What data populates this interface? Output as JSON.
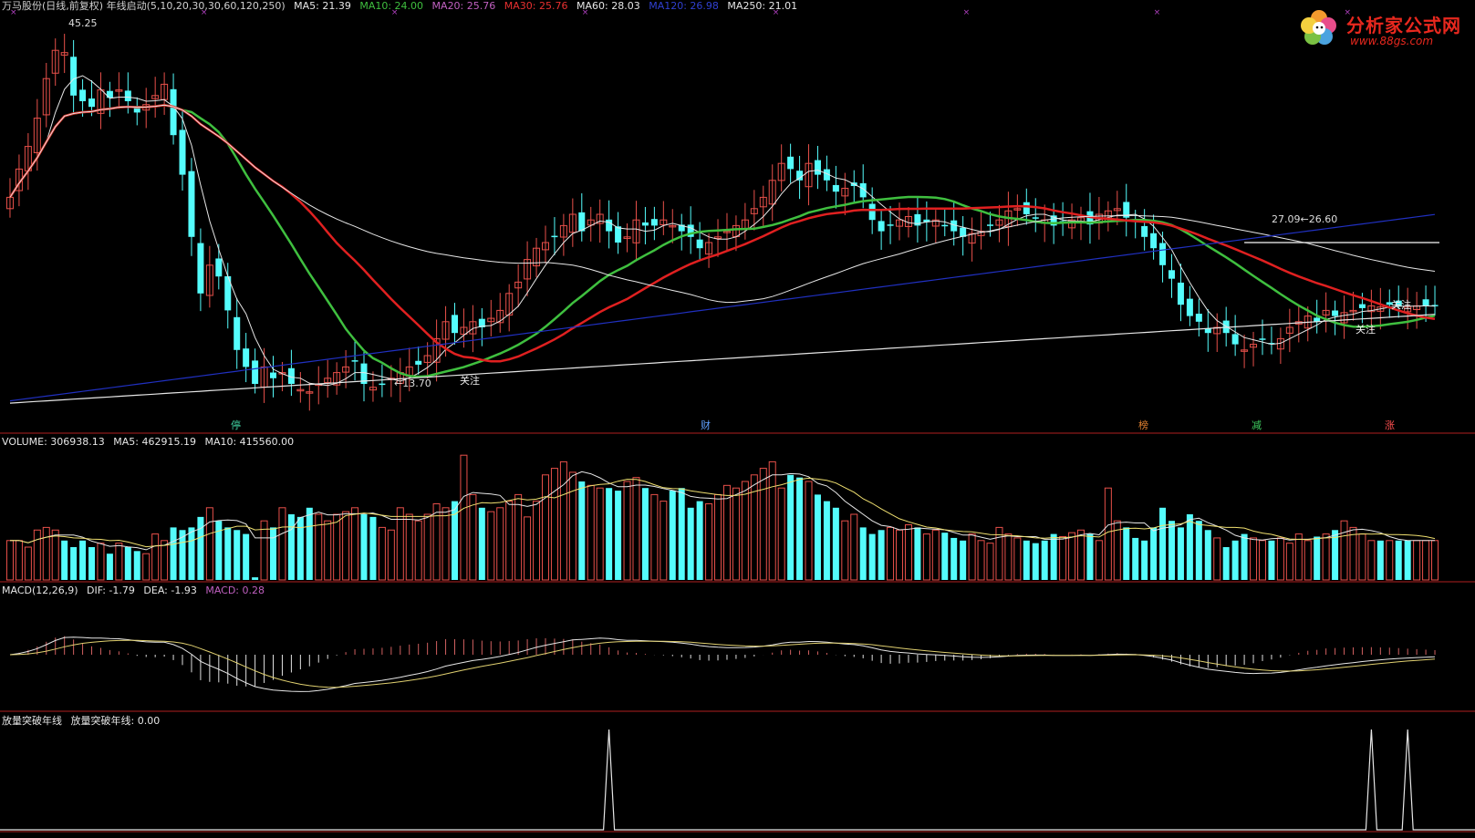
{
  "header": {
    "title": "万马股份(日线,前复权) 年线启动(5,10,20,30,30,60,120,250)",
    "ma": [
      {
        "label": "MA5: 21.39",
        "color": "#e6e6e6"
      },
      {
        "label": "MA10: 24.00",
        "color": "#3fbf3f"
      },
      {
        "label": "MA20: 25.76",
        "color": "#c060c0"
      },
      {
        "label": "MA30: 25.76",
        "color": "#e83030"
      },
      {
        "label": "MA60: 28.03",
        "color": "#e6e6e6"
      },
      {
        "label": "MA120: 26.98",
        "color": "#3040d0"
      },
      {
        "label": "MA250: 21.01",
        "color": "#e6e6e6"
      }
    ]
  },
  "logo": {
    "text": "分析家公式网",
    "url": "www.88gs.com"
  },
  "price_annotations": {
    "high": "45.25",
    "low": "←13.70",
    "range": "27.09←26.60",
    "focus": "关注"
  },
  "bottom_markers": [
    "停",
    "财",
    "榜",
    "减",
    "涨"
  ],
  "volume_header": {
    "label": "VOLUME: 306938.13",
    "ma5": "MA5: 462915.19",
    "ma10": "MA10: 415560.00"
  },
  "macd_header": {
    "label": "MACD(12,26,9)",
    "dif": "DIF: -1.79",
    "dea": "DEA: -1.93",
    "macd": "MACD: 0.28"
  },
  "signal_header": {
    "label": "放量突破年线",
    "value": "放量突破年线: 0.00"
  },
  "colors": {
    "up": "#e8504a",
    "down": "#54fcfc",
    "white": "#e6e6e6",
    "green": "#3fbf3f",
    "red": "#e02020",
    "blue": "#2030c0",
    "divider": "#b02020",
    "macd_pos": "#d06060",
    "macd_neg": "#e0e0e0"
  },
  "chart_data": [
    {
      "type": "candlestick",
      "title": "万马股份(日线,前复权)",
      "x": [
        1,
        2,
        3,
        4,
        5,
        6,
        7,
        8,
        9,
        10,
        11,
        12,
        13,
        14,
        15,
        16,
        17,
        18,
        19,
        20,
        21,
        22,
        23,
        24,
        25,
        26,
        27,
        28,
        29,
        30,
        31,
        32,
        33,
        34,
        35,
        36,
        37,
        38,
        39,
        40,
        41,
        42,
        43,
        44,
        45,
        46,
        47,
        48,
        49,
        50,
        51,
        52,
        53,
        54,
        55,
        56,
        57,
        58,
        59,
        60,
        61,
        62,
        63,
        64,
        65,
        66,
        67,
        68,
        69,
        70,
        71,
        72,
        73,
        74,
        75,
        76,
        77,
        78,
        79,
        80,
        81,
        82,
        83,
        84,
        85,
        86,
        87,
        88,
        89,
        90,
        91,
        92,
        93,
        94,
        95,
        96,
        97,
        98,
        99,
        100,
        101,
        102,
        103,
        104,
        105,
        106,
        107,
        108,
        109,
        110,
        111,
        112,
        113,
        114,
        115,
        116,
        117,
        118,
        119,
        120,
        121,
        122,
        123,
        124,
        125,
        126,
        127,
        128,
        129,
        130,
        131,
        132,
        133,
        134,
        135,
        136,
        137,
        138,
        139,
        140,
        141,
        142,
        143,
        144,
        145,
        146,
        147,
        148,
        149,
        150,
        151,
        152,
        153,
        154,
        155,
        156,
        157,
        158
      ],
      "close": [
        31.0,
        33.5,
        35.5,
        38.0,
        41.5,
        44.0,
        43.8,
        40.0,
        39.5,
        39.0,
        40.5,
        39.8,
        40.5,
        39.5,
        38.5,
        39.2,
        40.0,
        41.0,
        36.5,
        33.0,
        27.5,
        22.5,
        25.0,
        24.0,
        21.0,
        17.5,
        16.0,
        14.5,
        16.0,
        15.0,
        15.5,
        14.5,
        14.0,
        13.8,
        14.5,
        15.0,
        15.5,
        16.0,
        16.5,
        14.5,
        14.2,
        14.5,
        15.0,
        15.5,
        16.0,
        16.2,
        17.0,
        18.5,
        20.0,
        19.0,
        19.5,
        20.0,
        19.5,
        20.3,
        21.0,
        22.5,
        23.5,
        25.5,
        26.5,
        27.0,
        27.5,
        28.5,
        29.5,
        28.0,
        29.0,
        29.5,
        28.0,
        27.0,
        27.5,
        29.0,
        28.5,
        28.5,
        29.0,
        28.5,
        28.0,
        27.5,
        26.5,
        27.0,
        27.5,
        28.0,
        28.5,
        29.0,
        30.0,
        31.0,
        32.5,
        34.0,
        33.5,
        32.5,
        34.0,
        33.0,
        32.5,
        31.5,
        31.8,
        32.0,
        31.0,
        29.0,
        28.0,
        28.5,
        29.0,
        29.3,
        28.5,
        28.8,
        29.0,
        28.5,
        28.0,
        27.5,
        27.8,
        28.0,
        28.5,
        29.0,
        29.8,
        30.0,
        29.5,
        29.2,
        29.0,
        28.5,
        28.8,
        29.0,
        29.2,
        28.6,
        29.5,
        29.8,
        30.0,
        29.2,
        29.0,
        27.5,
        26.5,
        25.0,
        23.8,
        21.5,
        20.5,
        20.0,
        19.0,
        19.5,
        19.0,
        18.0,
        17.5,
        18.0,
        18.5,
        18.0,
        18.5,
        19.5,
        20.0,
        20.5,
        20.0,
        21.0,
        20.5,
        20.8,
        21.0,
        21.2,
        21.4,
        21.3,
        21.5,
        21.4,
        21.3,
        21.4,
        21.4,
        21.4
      ],
      "ylim": [
        12,
        47
      ],
      "annotations": [
        "45.25",
        "←13.70",
        "27.09←26.60",
        "关注",
        "关注",
        "关注"
      ]
    },
    {
      "type": "bar",
      "title": "VOLUME",
      "values": [
        30,
        30,
        25,
        38,
        40,
        38,
        30,
        25,
        30,
        25,
        28,
        20,
        28,
        25,
        22,
        20,
        35,
        30,
        40,
        38,
        40,
        48,
        55,
        45,
        40,
        38,
        35,
        2,
        45,
        40,
        55,
        50,
        48,
        55,
        50,
        45,
        50,
        52,
        55,
        50,
        48,
        40,
        38,
        55,
        50,
        45,
        50,
        58,
        55,
        60,
        95,
        65,
        55,
        52,
        55,
        60,
        65,
        48,
        60,
        80,
        85,
        90,
        82,
        75,
        72,
        70,
        70,
        68,
        75,
        78,
        70,
        65,
        60,
        68,
        70,
        55,
        60,
        58,
        65,
        72,
        70,
        75,
        80,
        85,
        90,
        70,
        80,
        78,
        75,
        65,
        60,
        55,
        45,
        50,
        40,
        35,
        38,
        40,
        38,
        42,
        40,
        35,
        38,
        36,
        32,
        30,
        35,
        30,
        28,
        40,
        35,
        32,
        30,
        28,
        30,
        35,
        33,
        36,
        38,
        35,
        30,
        70,
        45,
        40,
        32,
        30,
        40,
        55,
        45,
        40,
        50,
        45,
        38,
        32,
        25,
        30,
        35,
        32,
        30,
        30,
        32,
        28,
        35,
        30,
        33,
        35,
        38,
        45,
        40,
        35,
        30,
        30,
        30,
        30,
        30,
        30,
        30,
        30
      ],
      "ma5": "462915.19",
      "ma10": "415560.00"
    },
    {
      "type": "line",
      "title": "MACD(12,26,9)",
      "series": [
        {
          "name": "DIF",
          "value": -1.79
        },
        {
          "name": "DEA",
          "value": -1.93
        },
        {
          "name": "MACD",
          "value": 0.28
        }
      ]
    },
    {
      "type": "line",
      "title": "放量突破年线",
      "series": [
        {
          "name": "放量突破年线",
          "value": 0.0
        }
      ],
      "signals_at_index": [
        66,
        150,
        154
      ]
    }
  ]
}
